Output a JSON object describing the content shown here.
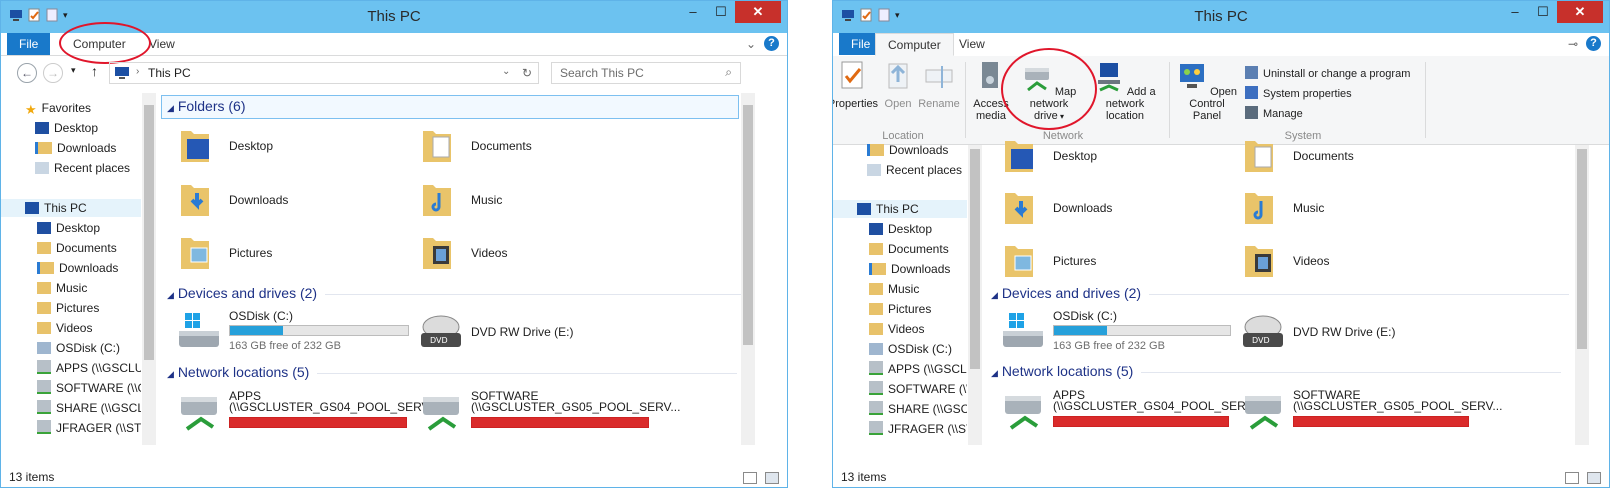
{
  "left": {
    "title": "This PC",
    "tabs": {
      "file": "File",
      "computer": "Computer",
      "view": "View"
    },
    "address": {
      "path": "This PC",
      "search_placeholder": "Search This PC"
    },
    "nav": {
      "favorites": "Favorites",
      "fav_items": [
        "Desktop",
        "Downloads",
        "Recent places"
      ],
      "thispc": "This PC",
      "pc_items": [
        "Desktop",
        "Documents",
        "Downloads",
        "Music",
        "Pictures",
        "Videos",
        "OSDisk (C:)",
        "APPS (\\\\GSCLUST",
        "SOFTWARE (\\\\GS",
        "SHARE (\\\\GSCLU",
        "JFRAGER (\\\\STUH"
      ]
    },
    "groups": {
      "folders": "Folders (6)",
      "devices": "Devices and drives (2)",
      "network": "Network locations (5)"
    },
    "folders": [
      "Desktop",
      "Documents",
      "Downloads",
      "Music",
      "Pictures",
      "Videos"
    ],
    "drives": {
      "c_label": "OSDisk (C:)",
      "c_free": "163 GB free of 232 GB",
      "c_used_fraction": 0.3,
      "dvd_label": "DVD RW Drive (E:)"
    },
    "net": [
      {
        "name": "APPS",
        "path": "(\\\\GSCLUSTER_GS04_POOL_SERV..."
      },
      {
        "name": "SOFTWARE",
        "path": "(\\\\GSCLUSTER_GS05_POOL_SERV..."
      }
    ],
    "status": "13 items"
  },
  "right": {
    "title": "This PC",
    "tabs": {
      "file": "File",
      "computer": "Computer",
      "view": "View"
    },
    "ribbon": {
      "properties": "Properties",
      "open": "Open",
      "rename": "Rename",
      "location_group": "Location",
      "access_media_1": "Access",
      "access_media_2": "media",
      "map_drive_1": "Map network",
      "map_drive_2": "drive",
      "add_location_1": "Add a network",
      "add_location_2": "location",
      "network_group": "Network",
      "control_panel_1": "Open Control",
      "control_panel_2": "Panel",
      "uninstall": "Uninstall or change a program",
      "sysprops": "System properties",
      "manage": "Manage",
      "system_group": "System"
    },
    "nav": {
      "fav_items": [
        "Downloads",
        "Recent places"
      ],
      "thispc": "This PC",
      "pc_items": [
        "Desktop",
        "Documents",
        "Downloads",
        "Music",
        "Pictures",
        "Videos",
        "OSDisk (C:)",
        "APPS (\\\\GSCLUST",
        "SOFTWARE (\\\\GS",
        "SHARE (\\\\GSCLU",
        "JFRAGER (\\\\STUH"
      ]
    },
    "groups": {
      "devices": "Devices and drives (2)",
      "network": "Network locations (5)"
    },
    "folders": [
      "Desktop",
      "Documents",
      "Downloads",
      "Music",
      "Pictures",
      "Videos"
    ],
    "drives": {
      "c_label": "OSDisk (C:)",
      "c_free": "163 GB free of 232 GB",
      "c_used_fraction": 0.3,
      "dvd_label": "DVD RW Drive (E:)"
    },
    "net": [
      {
        "name": "APPS",
        "path": "(\\\\GSCLUSTER_GS04_POOL_SERV..."
      },
      {
        "name": "SOFTWARE",
        "path": "(\\\\GSCLUSTER_GS05_POOL_SERV..."
      }
    ],
    "status": "13 items"
  },
  "colors": {
    "titlebar": "#6cc2f0",
    "file_tab": "#1979ca",
    "close": "#c7302b",
    "group_text": "#1e3287",
    "drive_bar": "#26a0da",
    "net_bar": "#da2b2b",
    "highlight": "#e0162b"
  }
}
